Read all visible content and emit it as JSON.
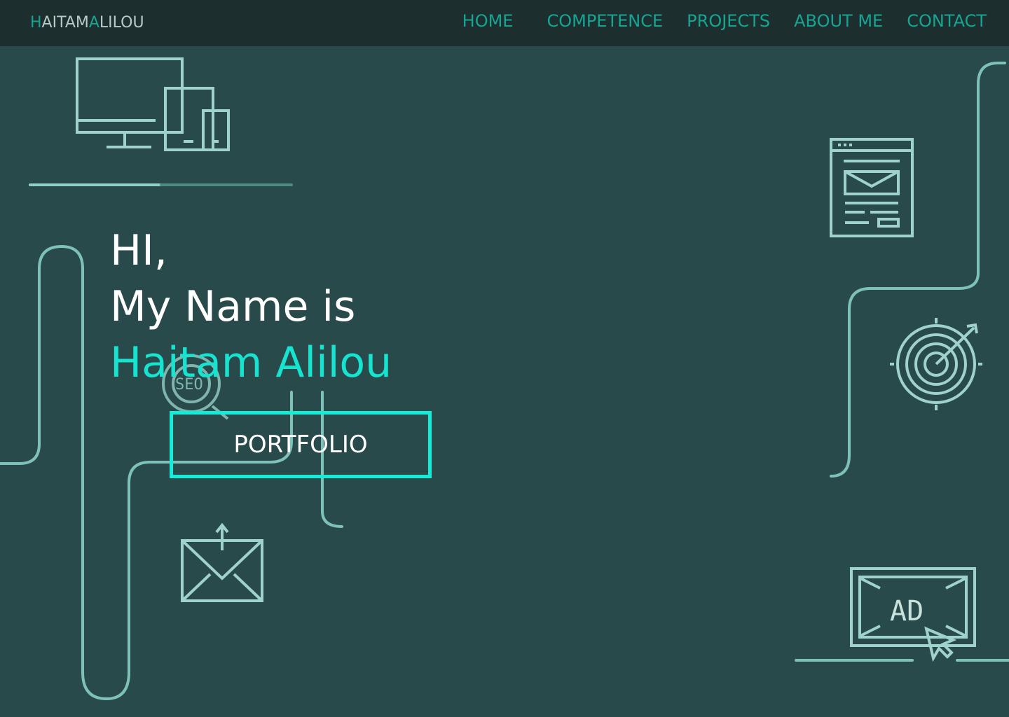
{
  "brand": {
    "first_initial": "H",
    "first_rest": "AITAM",
    "last_initial": "A",
    "last_rest": "LILOU"
  },
  "nav": {
    "items": [
      "HOME",
      "COMPETENCE",
      "PROJECTS",
      "ABOUT ME",
      "CONTACT"
    ]
  },
  "hero": {
    "greeting": "HI,",
    "intro": "My Name is",
    "name": "Haitam Alilou",
    "button_label": "PORTFOLIO"
  },
  "icons": {
    "seo_label": "SEO",
    "ad_label": "AD"
  },
  "colors": {
    "background": "#294a4a",
    "navbar": "#1c2f2e",
    "accent": "#16e4d0",
    "nav_text": "#17a593",
    "line": "#7ec1bb"
  }
}
